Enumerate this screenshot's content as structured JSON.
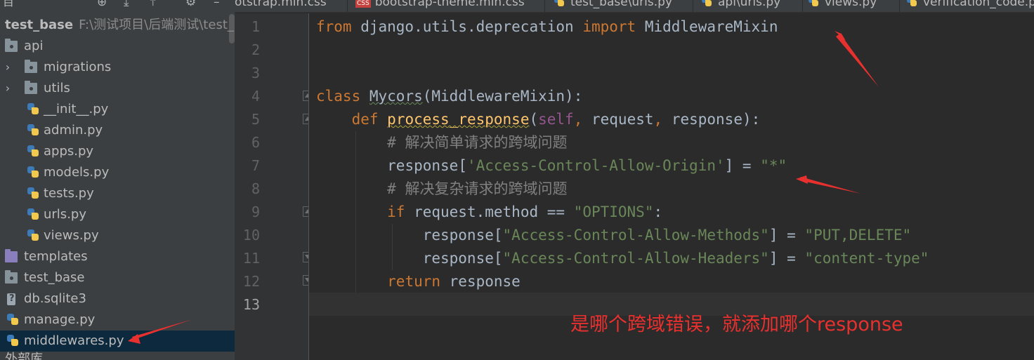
{
  "sidebar": {
    "menu_label": "目",
    "root_name": "test_base",
    "root_path": "F:\\测试项目\\后端测试\\test_ba",
    "items": [
      {
        "label": "api"
      },
      {
        "label": "migrations"
      },
      {
        "label": "utils"
      },
      {
        "label": "__init__.py"
      },
      {
        "label": "admin.py"
      },
      {
        "label": "apps.py"
      },
      {
        "label": "models.py"
      },
      {
        "label": "tests.py"
      },
      {
        "label": "urls.py"
      },
      {
        "label": "views.py"
      },
      {
        "label": "templates"
      },
      {
        "label": "test_base"
      },
      {
        "label": "db.sqlite3"
      },
      {
        "label": "manage.py"
      },
      {
        "label": "middlewares.py"
      },
      {
        "label": "外部库"
      }
    ]
  },
  "tabs": [
    {
      "label": "otstrap.min.css"
    },
    {
      "label": "bootstrap-theme.min.css"
    },
    {
      "label": "test_base\\urls.py"
    },
    {
      "label": "api\\urls.py"
    },
    {
      "label": "views.py"
    },
    {
      "label": "verification_code.p"
    }
  ],
  "tab_badge": "CSS",
  "editor": {
    "current_line": 13,
    "lines": [
      {
        "num": "1"
      },
      {
        "num": "2"
      },
      {
        "num": "3"
      },
      {
        "num": "4"
      },
      {
        "num": "5"
      },
      {
        "num": "6"
      },
      {
        "num": "7"
      },
      {
        "num": "8"
      },
      {
        "num": "9"
      },
      {
        "num": "10"
      },
      {
        "num": "11"
      },
      {
        "num": "12"
      },
      {
        "num": "13"
      }
    ],
    "code": {
      "l1": {
        "kw_from": "from",
        "module": " django.utils.deprecation ",
        "kw_import": "import",
        "name": " MiddlewareMixin"
      },
      "l4": {
        "kw_class": "class",
        "sp": " ",
        "cls": "Mycors",
        "open": "(",
        "base": "MiddlewareMixin",
        "close": "):"
      },
      "l5": {
        "indent": "    ",
        "kw_def": "def",
        "sp": " ",
        "fn": "process_response",
        "open": "(",
        "self": "self",
        "c1": ",",
        "p1": " request",
        "c2": ",",
        "p2": " response",
        "close": "):"
      },
      "l6": {
        "indent": "        ",
        "comment": "# 解决简单请求的跨域问题"
      },
      "l7": {
        "indent": "        ",
        "var": "response",
        "ob": "[",
        "key": "'Access-Control-Allow-Origin'",
        "cb": "]",
        "eq": " = ",
        "val": "\"*\""
      },
      "l8": {
        "indent": "        ",
        "comment": "# 解决复杂请求的跨域问题"
      },
      "l9": {
        "indent": "        ",
        "kw_if": "if",
        "cond": " request.method == ",
        "val": "\"OPTIONS\"",
        "colon": ":"
      },
      "l10": {
        "indent": "            ",
        "var": "response",
        "ob": "[",
        "key": "\"Access-Control-Allow-Methods\"",
        "cb": "]",
        "eq": " = ",
        "val": "\"PUT,DELETE\""
      },
      "l11": {
        "indent": "            ",
        "var": "response",
        "ob": "[",
        "key": "\"Access-Control-Allow-Headers\"",
        "cb": "]",
        "eq": " = ",
        "val": "\"content-type\""
      },
      "l12": {
        "indent": "        ",
        "kw_return": "return",
        "rest": " response"
      }
    }
  },
  "annotation": {
    "text": "是哪个跨域错误，就添加哪个response",
    "color": "#e8312f"
  }
}
